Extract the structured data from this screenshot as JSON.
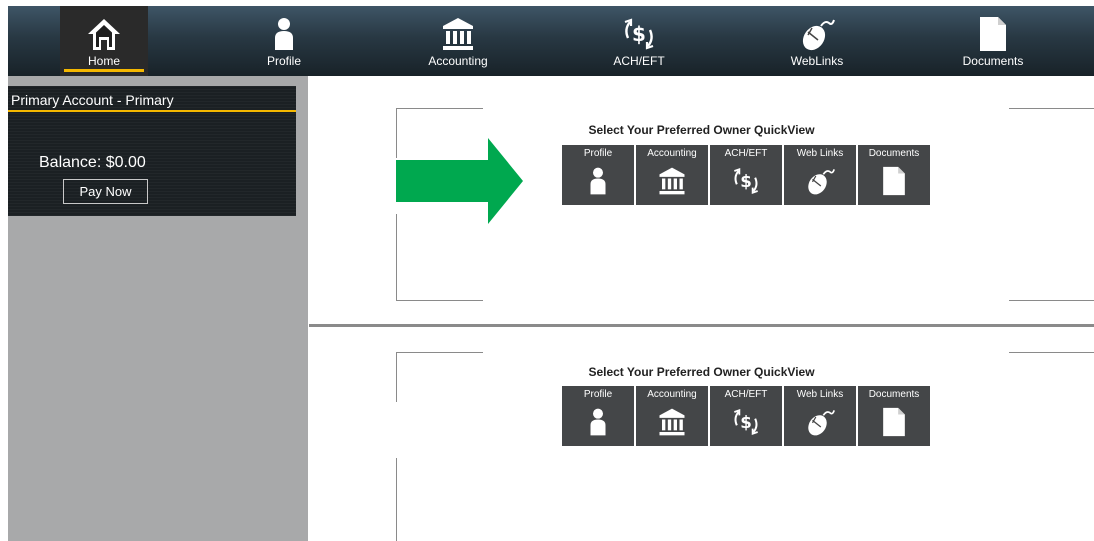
{
  "nav": {
    "items": [
      {
        "label": "Home",
        "icon": "home-icon"
      },
      {
        "label": "Profile",
        "icon": "person-icon"
      },
      {
        "label": "Accounting",
        "icon": "bank-icon"
      },
      {
        "label": "ACH/EFT",
        "icon": "dollar-cycle-icon"
      },
      {
        "label": "WebLinks",
        "icon": "mouse-icon"
      },
      {
        "label": "Documents",
        "icon": "document-icon"
      }
    ],
    "active": "Home"
  },
  "sidebar": {
    "account_title": "Primary Account - Primary",
    "balance": "Balance: $0.00",
    "pay_now_label": "Pay Now"
  },
  "quickview": [
    {
      "title": "Select Your Preferred Owner QuickView",
      "tiles": [
        "Profile",
        "Accounting",
        "ACH/EFT",
        "Web Links",
        "Documents"
      ]
    },
    {
      "title": "Select Your Preferred Owner QuickView",
      "tiles": [
        "Profile",
        "Accounting",
        "ACH/EFT",
        "Web Links",
        "Documents"
      ]
    }
  ],
  "colors": {
    "accent": "#f5b800",
    "arrow": "#00a84f",
    "tile": "#444648",
    "sidebar": "#a8a9aa",
    "panel": "#1b2023"
  }
}
